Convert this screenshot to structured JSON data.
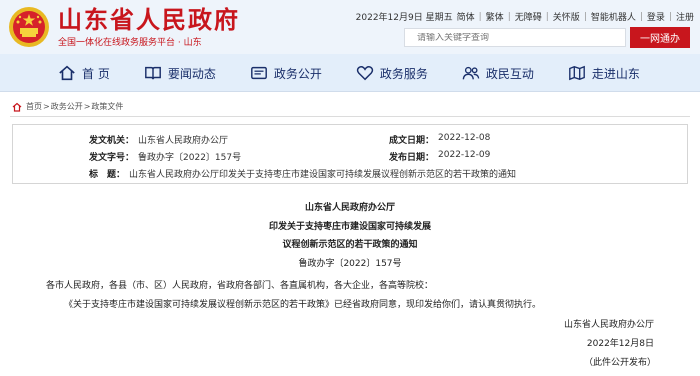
{
  "header": {
    "site_title": "山东省人民政府",
    "site_subtitle": "全国一体化在线政务服务平台 · 山东",
    "date": "2022年12月9日 星期五",
    "top_links": [
      "简体",
      "繁体",
      "无障碍",
      "关怀版",
      "智能机器人",
      "登录",
      "注册"
    ],
    "search_placeholder": "请输入关键字查询",
    "search_button": "一网通办",
    "brand_color": "#c8161d"
  },
  "nav": {
    "items": [
      {
        "label": "首 页",
        "icon": "home-icon"
      },
      {
        "label": "要闻动态",
        "icon": "book-icon"
      },
      {
        "label": "政务公开",
        "icon": "newspaper-icon"
      },
      {
        "label": "政务服务",
        "icon": "heart-icon"
      },
      {
        "label": "政民互动",
        "icon": "people-icon"
      },
      {
        "label": "走进山东",
        "icon": "map-pin-icon"
      }
    ]
  },
  "breadcrumb": {
    "items": [
      "首页",
      "政务公开",
      "政策文件"
    ],
    "icon": "home-icon"
  },
  "info": {
    "issuer_label": "发文机关：",
    "issuer": "山东省人民政府办公厅",
    "doc_no_label": "发文字号：",
    "doc_no": "鲁政办字〔2022〕157号",
    "title_label": "标　题：",
    "title": "山东省人民政府办公厅印发关于支持枣庄市建设国家可持续发展议程创新示范区的若干政策的通知",
    "created_label": "成文日期：",
    "created": "2022-12-08",
    "published_label": "发布日期：",
    "published": "2022-12-09"
  },
  "document": {
    "issuer_heading": "山东省人民政府办公厅",
    "title_line1": "印发关于支持枣庄市建设国家可持续发展",
    "title_line2": "议程创新示范区的若干政策的通知",
    "doc_no": "鲁政办字〔2022〕157号",
    "recipients": "各市人民政府，各县（市、区）人民政府，省政府各部门、各直属机构，各大企业，各高等院校：",
    "body": "《关于支持枣庄市建设国家可持续发展议程创新示范区的若干政策》已经省政府同意，现印发给你们，请认真贯彻执行。",
    "signature": "山东省人民政府办公厅",
    "sign_date": "2022年12月8日",
    "publish_note": "（此件公开发布）"
  }
}
